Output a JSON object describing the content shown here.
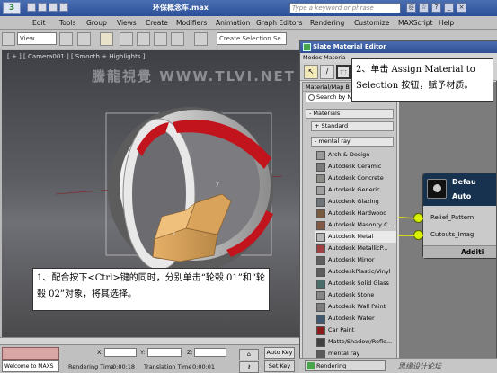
{
  "app": {
    "title": "环保概念车.max",
    "search_placeholder": "Type a keyword or phrase"
  },
  "menubar": [
    "Edit",
    "Tools",
    "Group",
    "Views",
    "Create",
    "Modifiers",
    "Animation",
    "Graph Editors",
    "Rendering",
    "Customize",
    "MAXScript",
    "Help"
  ],
  "toolbar": {
    "view_select": "View",
    "selection_set_placeholder": "Create Selection Se"
  },
  "viewport": {
    "label": "[ + ] [ Camera001 ] [ Smooth + Highlights ]",
    "watermark": "騰龍視覺 WWW.TLVI.NET"
  },
  "callouts": {
    "step1": "1、配合按下<Ctrl>键的同时，分别单击“轮毂 01”和“轮毂 02”对象，将其选择。",
    "step2": "2、单击 Assign Material to Selection 按钮，赋予材质。"
  },
  "slate": {
    "title": "Slate Material Editor",
    "menu": "Modes  Materia",
    "browser_header": "Material/Map B",
    "search_label": "Search by Na",
    "sections": {
      "materials": "- Materials",
      "standard": "+ Standard",
      "mental_ray": "- mental ray"
    },
    "materials": [
      {
        "name": "Arch & Design",
        "color": "#9a9a9a"
      },
      {
        "name": "Autodesk Ceramic",
        "color": "#7b7b7b"
      },
      {
        "name": "Autodesk Concrete",
        "color": "#8a8a86"
      },
      {
        "name": "Autodesk Generic",
        "color": "#9f9f9f"
      },
      {
        "name": "Autodesk Glazing",
        "color": "#6c7478"
      },
      {
        "name": "Autodesk Hardwood",
        "color": "#7a5a3e"
      },
      {
        "name": "Autodesk Masonry C...",
        "color": "#855a45"
      },
      {
        "name": "Autodesk Metal",
        "color": "#b7b7b7"
      },
      {
        "name": "Autodesk MetallicP...",
        "color": "#a04040"
      },
      {
        "name": "Autodesk Mirror",
        "color": "#5e5e5e"
      },
      {
        "name": "AutodeskPlastic/Vinyl",
        "color": "#5c5c5c"
      },
      {
        "name": "Autodesk Solid Glass",
        "color": "#4b6d6a"
      },
      {
        "name": "Autodesk Stone",
        "color": "#868686"
      },
      {
        "name": "Autodesk Wall Paint",
        "color": "#7c7c7c"
      },
      {
        "name": "Autodesk Water",
        "color": "#3f5a70"
      },
      {
        "name": "Car Paint",
        "color": "#8a1c1c"
      },
      {
        "name": "Matte/Shadow/Refle...",
        "color": "#404040"
      },
      {
        "name": "mental ray",
        "color": "#5a5a5a"
      }
    ],
    "node": {
      "title_line1": "Defau",
      "title_line2": "Auto",
      "slots": [
        "Relief_Pattern",
        "Cutouts_Imag"
      ],
      "footer": "Additi"
    }
  },
  "status": {
    "x_label": "X:",
    "y_label": "Y:",
    "z_label": "Z:",
    "welcome": "Welcome to MAXS",
    "rendering_time_label": "Rendering Time",
    "rendering_time_value": "0:00:18",
    "translation_time_label": "Translation Time",
    "translation_time_value": "0:00:01",
    "auto_key": "Auto Key",
    "set_key": "Set Key",
    "taskbar_item": "Rendering",
    "watermark": "思缘设计论坛"
  },
  "colors": {
    "title_bar": "#2b4f98",
    "node_header": "#16324e",
    "slot_dot": "#d4f000",
    "wheel_red": "#c2141c"
  }
}
